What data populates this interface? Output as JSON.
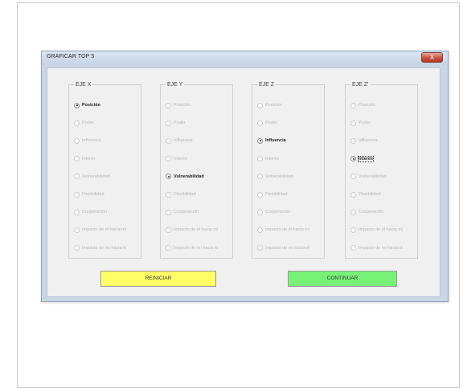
{
  "dialog": {
    "title": "GRAFICAR TOP 5",
    "close_label": "X"
  },
  "groups": [
    {
      "title": "EJE X",
      "options": [
        {
          "label": "Posición",
          "checked": true
        },
        {
          "label": "Poder",
          "checked": false
        },
        {
          "label": "Influencia",
          "checked": false
        },
        {
          "label": "Interés",
          "checked": false
        },
        {
          "label": "Vulnerabilidad",
          "checked": false
        },
        {
          "label": "Flexibilidad",
          "checked": false
        },
        {
          "label": "Cooperación",
          "checked": false
        },
        {
          "label": "Impacto de él hacia mí",
          "checked": false
        },
        {
          "label": "Impacto de mí hacia él",
          "checked": false
        }
      ]
    },
    {
      "title": "EJE Y",
      "options": [
        {
          "label": "Posición",
          "checked": false
        },
        {
          "label": "Poder",
          "checked": false
        },
        {
          "label": "Influencia",
          "checked": false
        },
        {
          "label": "Interés",
          "checked": false
        },
        {
          "label": "Vulnerabilidad",
          "checked": true
        },
        {
          "label": "Flexibilidad",
          "checked": false
        },
        {
          "label": "Cooperación",
          "checked": false
        },
        {
          "label": "Impacto de él hacia mí",
          "checked": false
        },
        {
          "label": "Impacto de mí hacia él",
          "checked": false
        }
      ]
    },
    {
      "title": "EJE Z",
      "options": [
        {
          "label": "Posición",
          "checked": false
        },
        {
          "label": "Poder",
          "checked": false
        },
        {
          "label": "Influencia",
          "checked": true
        },
        {
          "label": "Interés",
          "checked": false
        },
        {
          "label": "Vulnerabilidad",
          "checked": false
        },
        {
          "label": "Flexibilidad",
          "checked": false
        },
        {
          "label": "Cooperación",
          "checked": false
        },
        {
          "label": "Impacto de él hacia mí",
          "checked": false
        },
        {
          "label": "Impacto de mí hacia él",
          "checked": false
        }
      ]
    },
    {
      "title": "EJE Z'",
      "options": [
        {
          "label": "Posición",
          "checked": false
        },
        {
          "label": "Poder",
          "checked": false
        },
        {
          "label": "Influencia",
          "checked": false
        },
        {
          "label": "Interés",
          "checked": true,
          "focused": true
        },
        {
          "label": "Vulnerabilidad",
          "checked": false
        },
        {
          "label": "Flexibilidad",
          "checked": false
        },
        {
          "label": "Cooperación",
          "checked": false
        },
        {
          "label": "Impacto de él hacia mí",
          "checked": false
        },
        {
          "label": "Impacto de mí hacia él",
          "checked": false
        }
      ]
    }
  ],
  "buttons": {
    "reset_label": "REINICIAR",
    "continue_label": "CONTINUAR"
  },
  "colors": {
    "reset_button": "#ffff66",
    "continue_button": "#77f277",
    "window_frame": "#c9d6e6"
  }
}
